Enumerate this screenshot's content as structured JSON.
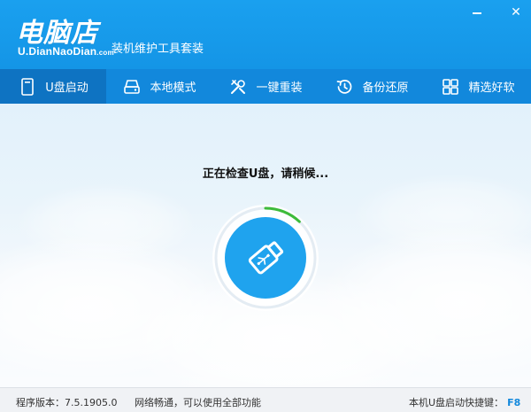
{
  "app": {
    "logo_title": "电脑店",
    "logo_url_main": "U.DianNaoDian",
    "logo_url_suffix": ".com",
    "subtitle": "装机维护工具套装"
  },
  "window_controls": {
    "minimize_icon": "minimize-icon",
    "close_label": "✕"
  },
  "tabs": [
    {
      "label": "U盘启动",
      "icon": "usb-drive-icon",
      "active": true
    },
    {
      "label": "本地模式",
      "icon": "hard-disk-icon",
      "active": false
    },
    {
      "label": "一键重装",
      "icon": "tools-icon",
      "active": false
    },
    {
      "label": "备份还原",
      "icon": "restore-icon",
      "active": false
    },
    {
      "label": "精选好软",
      "icon": "grid-apps-icon",
      "active": false
    }
  ],
  "main": {
    "status_message": "正在检查U盘，请稍候...",
    "progress_fraction": 0.12,
    "center_icon": "usb-stick-icon"
  },
  "statusbar": {
    "version_label": "程序版本：",
    "version_value": "7.5.1905.0",
    "network_status": "网络畅通，可以使用全部功能",
    "hotkey_label": "本机U盘启动快捷键：",
    "hotkey_value": "F8"
  },
  "colors": {
    "title_blue": "#1aa0ef",
    "tab_blue": "#1288dc",
    "tab_active": "#0e73c2",
    "progress_green": "#3dbb3a",
    "icon_circle": "#1fa3ee"
  }
}
